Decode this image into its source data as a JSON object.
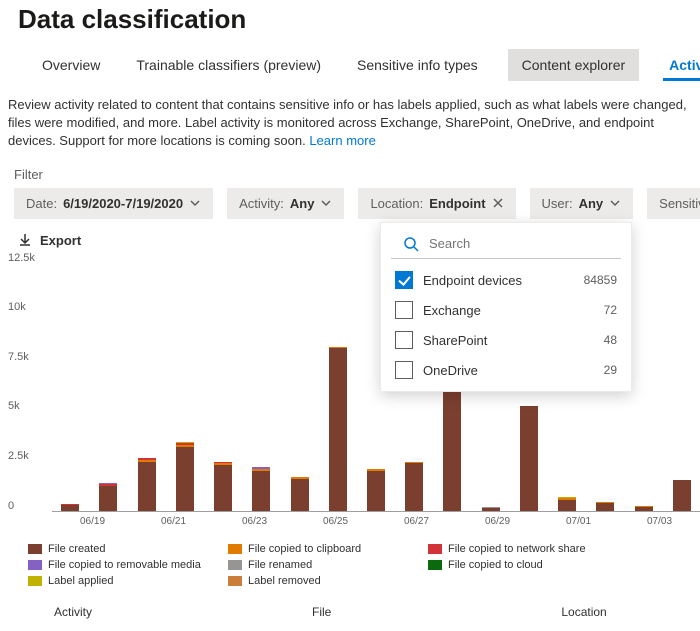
{
  "title": "Data classification",
  "tabs": [
    {
      "label": "Overview"
    },
    {
      "label": "Trainable classifiers (preview)"
    },
    {
      "label": "Sensitive info types"
    },
    {
      "label": "Content explorer",
      "highlight": true
    },
    {
      "label": "Activity explorer",
      "active": true
    }
  ],
  "description": "Review activity related to content that contains sensitive info or has labels applied, such as what labels were changed, files were modified, and more. Label activity is monitored across Exchange, SharePoint, OneDrive, and endpoint devices. Support for more locations is coming soon.",
  "learn_more": "Learn more",
  "filter_label": "Filter",
  "filters": {
    "date": {
      "label": "Date:",
      "value": "6/19/2020-7/19/2020"
    },
    "activity": {
      "label": "Activity:",
      "value": "Any"
    },
    "location": {
      "label": "Location:",
      "value": "Endpoint"
    },
    "user": {
      "label": "User:",
      "value": "Any"
    },
    "sensitivity": {
      "label": "Sensitivity"
    }
  },
  "export": "Export",
  "dropdown": {
    "search_placeholder": "Search",
    "options": [
      {
        "name": "Endpoint devices",
        "count": 84859,
        "checked": true
      },
      {
        "name": "Exchange",
        "count": 72,
        "checked": false
      },
      {
        "name": "SharePoint",
        "count": 48,
        "checked": false
      },
      {
        "name": "OneDrive",
        "count": 29,
        "checked": false
      }
    ]
  },
  "legend": [
    {
      "name": "File created",
      "color": "#7b3f2f"
    },
    {
      "name": "File copied to clipboard",
      "color": "#e07b00"
    },
    {
      "name": "File copied to network share",
      "color": "#d13438"
    },
    {
      "name": "File copied to removable media",
      "color": "#8661c5"
    },
    {
      "name": "File renamed",
      "color": "#979593"
    },
    {
      "name": "File copied to cloud",
      "color": "#0b6a0b"
    },
    {
      "name": "Label applied",
      "color": "#c2b200"
    },
    {
      "name": "Label removed",
      "color": "#c97f3a"
    }
  ],
  "footer_cols": [
    "Activity",
    "File",
    "Location"
  ],
  "chart_data": {
    "type": "bar",
    "ylim": [
      0,
      12500
    ],
    "yticks": [
      "12.5k",
      "10k",
      "7.5k",
      "5k",
      "2.5k",
      "0"
    ],
    "xticks": [
      "06/19",
      "06/21",
      "06/23",
      "06/25",
      "06/27",
      "06/29",
      "07/01",
      "07/03"
    ],
    "columns": [
      {
        "segments": [
          {
            "c": "#7b3f2f",
            "v": 250
          },
          {
            "c": "#d13438",
            "v": 60
          }
        ]
      },
      {
        "segments": [
          {
            "c": "#7b3f2f",
            "v": 1200
          },
          {
            "c": "#d13438",
            "v": 60
          },
          {
            "c": "#8661c5",
            "v": 60
          }
        ]
      },
      {
        "segments": [
          {
            "c": "#7b3f2f",
            "v": 2350
          },
          {
            "c": "#e07b00",
            "v": 100
          },
          {
            "c": "#d13438",
            "v": 60
          }
        ]
      },
      {
        "segments": [
          {
            "c": "#7b3f2f",
            "v": 3050
          },
          {
            "c": "#e07b00",
            "v": 100
          },
          {
            "c": "#d13438",
            "v": 80
          },
          {
            "c": "#c2b200",
            "v": 60
          }
        ]
      },
      {
        "segments": [
          {
            "c": "#7b3f2f",
            "v": 2200
          },
          {
            "c": "#e07b00",
            "v": 80
          },
          {
            "c": "#d13438",
            "v": 60
          }
        ]
      },
      {
        "segments": [
          {
            "c": "#7b3f2f",
            "v": 1900
          },
          {
            "c": "#e07b00",
            "v": 120
          },
          {
            "c": "#8661c5",
            "v": 60
          }
        ]
      },
      {
        "segments": [
          {
            "c": "#7b3f2f",
            "v": 1500
          },
          {
            "c": "#e07b00",
            "v": 120
          }
        ]
      },
      {
        "segments": [
          {
            "c": "#7b3f2f",
            "v": 7800
          },
          {
            "c": "#e07b00",
            "v": 60
          }
        ]
      },
      {
        "segments": [
          {
            "c": "#7b3f2f",
            "v": 1900
          },
          {
            "c": "#e07b00",
            "v": 80
          }
        ]
      },
      {
        "segments": [
          {
            "c": "#7b3f2f",
            "v": 2300
          },
          {
            "c": "#e07b00",
            "v": 60
          }
        ]
      },
      {
        "segments": [
          {
            "c": "#7b3f2f",
            "v": 7900
          }
        ]
      },
      {
        "segments": [
          {
            "c": "#7b3f2f",
            "v": 100
          },
          {
            "c": "#979593",
            "v": 60
          }
        ]
      },
      {
        "segments": [
          {
            "c": "#7b3f2f",
            "v": 5050
          }
        ]
      },
      {
        "segments": [
          {
            "c": "#7b3f2f",
            "v": 500
          },
          {
            "c": "#e07b00",
            "v": 100
          },
          {
            "c": "#c2b200",
            "v": 60
          }
        ]
      },
      {
        "segments": [
          {
            "c": "#7b3f2f",
            "v": 350
          },
          {
            "c": "#e07b00",
            "v": 80
          }
        ]
      },
      {
        "segments": [
          {
            "c": "#7b3f2f",
            "v": 150
          },
          {
            "c": "#e07b00",
            "v": 60
          }
        ]
      },
      {
        "segments": [
          {
            "c": "#7b3f2f",
            "v": 1450
          }
        ]
      }
    ]
  }
}
